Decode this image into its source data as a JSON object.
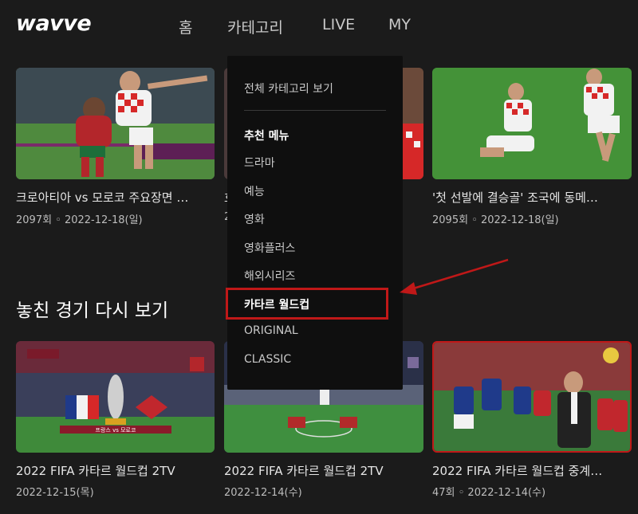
{
  "logo": "wavve",
  "nav": [
    "홈",
    "카테고리",
    "LIVE",
    "MY"
  ],
  "row1": [
    {
      "title": "크로아티아 vs 모로코 주요장면 …",
      "meta": "2097회 ◦ 2022-12-18(일)"
    },
    {
      "title": "흐",
      "meta": "2"
    },
    {
      "title": "'첫 선발에 결승골' 조국에 동메…",
      "meta": "2095회 ◦ 2022-12-18(일)"
    }
  ],
  "section_title": "놓친 경기 다시 보기",
  "row2": [
    {
      "title": "2022 FIFA 카타르 월드컵 2TV",
      "meta": "2022-12-15(목)",
      "scoreboard": "프랑스 vs 모로코"
    },
    {
      "title": "2022 FIFA 카타르 월드컵 2TV",
      "meta": "2022-12-14(수)"
    },
    {
      "title": "2022 FIFA 카타르 월드컵 중계…",
      "meta": "47회 ◦ 2022-12-14(수)"
    }
  ],
  "dropdown": {
    "header": "전체 카테고리 보기",
    "items": [
      "추천 메뉴",
      "드라마",
      "예능",
      "영화",
      "영화플러스",
      "해외시리즈",
      "카타르 월드컵",
      "ORIGINAL",
      "CLASSIC"
    ]
  },
  "colors": {
    "background": "#1b1b1b",
    "dropdown": "#0f0f0f",
    "highlight": "#c01818"
  }
}
